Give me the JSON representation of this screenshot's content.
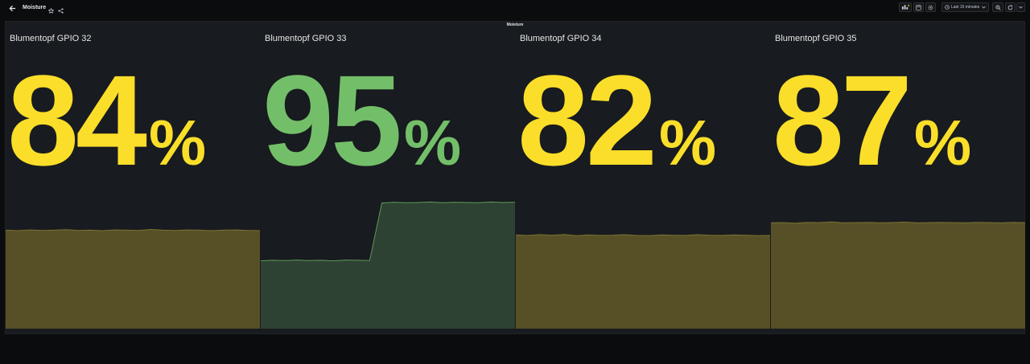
{
  "header": {
    "title": "Moisture",
    "time_range": "Last 15 minutes",
    "icons": [
      "arrow-left-icon",
      "star-icon",
      "share-icon",
      "add-panel-icon",
      "save-icon",
      "gear-icon",
      "clock-icon",
      "chevron-down-icon",
      "zoom-out-icon",
      "refresh-icon"
    ]
  },
  "row": {
    "title": "Moisture"
  },
  "colors": {
    "background": "#0b0c0e",
    "panel_bg": "#181b1f",
    "yellow": "#fade2a",
    "green": "#73bf69",
    "yellow_fill": "#575027",
    "green_fill": "#2e4233",
    "yellow_line": "#7a7232",
    "green_line": "#5e9a5a"
  },
  "panels": [
    {
      "title": "Blumentopf GPIO 32",
      "value": "84",
      "unit": "%",
      "color": "yellow",
      "series": [
        84.2,
        84.0,
        84.3,
        84.1,
        84.2,
        84.4,
        84.1,
        84.2,
        84.0,
        84.3,
        84.2,
        84.1,
        84.5,
        84.2,
        84.1,
        84.3,
        84.2,
        84.0,
        84.2,
        84.3,
        84.1,
        84.0
      ]
    },
    {
      "title": "Blumentopf GPIO 33",
      "value": "95",
      "unit": "%",
      "color": "green",
      "series": [
        72.0,
        72.2,
        72.1,
        72.3,
        72.1,
        72.2,
        72.0,
        72.3,
        72.2,
        72.1,
        95.0,
        95.3,
        95.1,
        95.2,
        95.4,
        95.1,
        95.3,
        95.2,
        95.1,
        95.4,
        95.2,
        95.3
      ]
    },
    {
      "title": "Blumentopf GPIO 34",
      "value": "82",
      "unit": "%",
      "color": "yellow",
      "series": [
        82.3,
        82.1,
        82.4,
        82.2,
        82.5,
        82.0,
        82.3,
        82.1,
        82.2,
        82.4,
        82.1,
        82.0,
        82.3,
        82.2,
        82.1,
        82.4,
        82.2,
        82.1,
        82.3,
        82.2,
        82.0,
        82.1
      ]
    },
    {
      "title": "Blumentopf GPIO 35",
      "value": "87",
      "unit": "%",
      "color": "yellow",
      "series": [
        87.1,
        87.2,
        87.0,
        87.3,
        87.2,
        87.5,
        87.1,
        87.2,
        87.3,
        87.1,
        87.2,
        87.4,
        87.1,
        87.2,
        87.3,
        87.2,
        87.1,
        87.3,
        87.2,
        87.1,
        87.3,
        87.2
      ]
    }
  ]
}
